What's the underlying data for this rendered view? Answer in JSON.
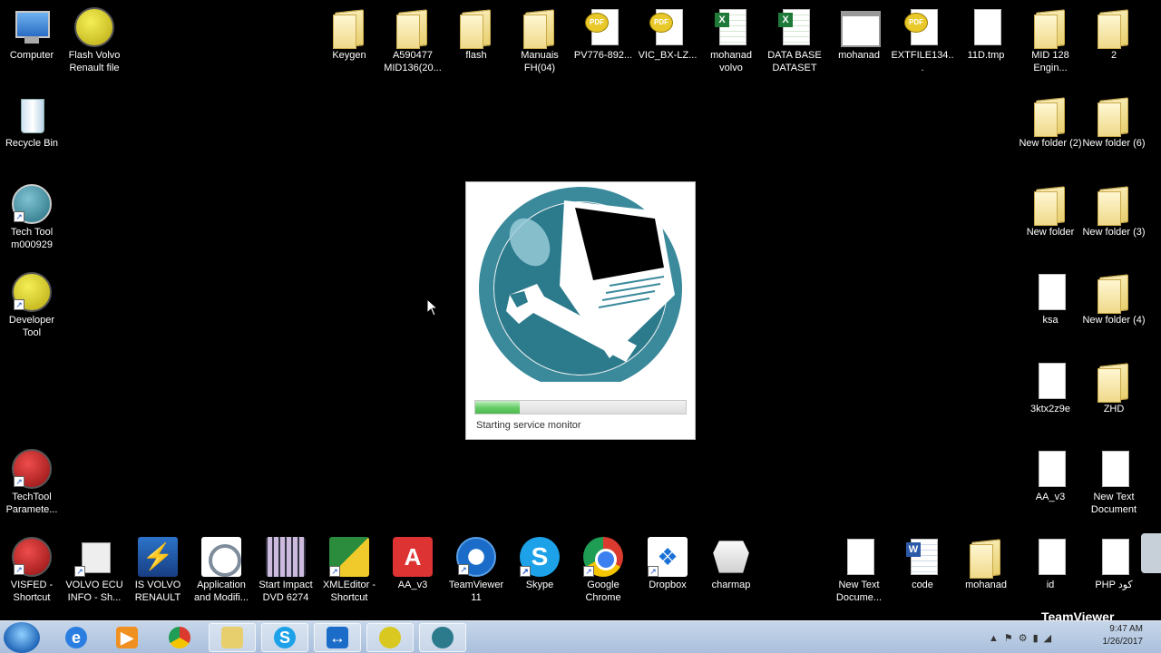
{
  "desktop_left": [
    {
      "label": "Computer",
      "icon": "computer-icon"
    },
    {
      "label": "Flash Volvo Renault file",
      "icon": "flash-volvo-icon"
    },
    {
      "label": "Recycle Bin",
      "icon": "recycle-bin-icon"
    },
    {
      "label": "Tech Tool m000929",
      "icon": "tech-tool-icon"
    },
    {
      "label": "Developer Tool",
      "icon": "developer-tool-icon"
    },
    {
      "label": "TechTool Paramete...",
      "icon": "techtool-parameter-icon"
    }
  ],
  "desktop_top": [
    {
      "label": "Keygen",
      "icon": "folder-icon"
    },
    {
      "label": "A590477 MID136(20...",
      "icon": "folder-icon"
    },
    {
      "label": "flash",
      "icon": "folder-icon"
    },
    {
      "label": "Manuais FH(04)",
      "icon": "folder-icon"
    },
    {
      "label": "PV776-892...",
      "icon": "pdf-icon"
    },
    {
      "label": "VIC_BX-LZ...",
      "icon": "pdf-icon"
    },
    {
      "label": "mohanad volvo",
      "icon": "excel-icon"
    },
    {
      "label": "DATA BASE DATASET",
      "icon": "excel-icon"
    },
    {
      "label": "mohanad",
      "icon": "window-icon"
    },
    {
      "label": "EXTFILE134...",
      "icon": "pdf-icon"
    },
    {
      "label": "11D.tmp",
      "icon": "file-icon"
    },
    {
      "label": "MID 128 Engin...",
      "icon": "folder-icon"
    },
    {
      "label": "2",
      "icon": "folder-icon"
    }
  ],
  "desktop_right": [
    {
      "label": "New folder (2)",
      "icon": "folder-icon"
    },
    {
      "label": "New folder (6)",
      "icon": "folder-icon"
    },
    {
      "label": "New folder",
      "icon": "folder-icon"
    },
    {
      "label": "New folder (3)",
      "icon": "folder-icon"
    },
    {
      "label": "ksa",
      "icon": "file-icon"
    },
    {
      "label": "New folder (4)",
      "icon": "folder-icon"
    },
    {
      "label": "3ktx2z9e",
      "icon": "file-icon"
    },
    {
      "label": "ZHD",
      "icon": "folder-icon"
    },
    {
      "label": "AA_v3",
      "icon": "file-icon"
    },
    {
      "label": "New Text Document",
      "icon": "text-file-icon"
    }
  ],
  "desktop_bottom": [
    {
      "label": "VISFED - Shortcut",
      "icon": "visfed-icon"
    },
    {
      "label": "VOLVO ECU INFO - Sh...",
      "icon": "volvo-ecu-icon"
    },
    {
      "label": "IS VOLVO RENAULT",
      "icon": "lightning-icon"
    },
    {
      "label": "Application and Modifi...",
      "icon": "volvo-logo-icon"
    },
    {
      "label": "Start Impact DVD 6274",
      "icon": "impact-icon"
    },
    {
      "label": "XMLEditor - Shortcut",
      "icon": "xmleditor-icon"
    },
    {
      "label": "AA_v3",
      "icon": "acrobat-icon"
    },
    {
      "label": "TeamViewer 11",
      "icon": "teamviewer-icon"
    },
    {
      "label": "Skype",
      "icon": "skype-icon"
    },
    {
      "label": "Google Chrome",
      "icon": "chrome-icon"
    },
    {
      "label": "Dropbox",
      "icon": "dropbox-icon"
    },
    {
      "label": "charmap",
      "icon": "charmap-icon"
    },
    {
      "label": "New Text Docume...",
      "icon": "text-file-icon"
    },
    {
      "label": "code",
      "icon": "word-icon"
    },
    {
      "label": "mohanad",
      "icon": "folder-icon"
    },
    {
      "label": "id",
      "icon": "file-icon"
    },
    {
      "label": "PHP كود",
      "icon": "file-icon"
    }
  ],
  "splash": {
    "status": "Starting service monitor",
    "progress": 0.21
  },
  "taskbar": {
    "items": [
      "ie-icon",
      "media-player-icon",
      "chrome-icon",
      "explorer-icon",
      "skype-icon",
      "teamviewer-icon",
      "flash-volvo-icon",
      "tech-tool-icon"
    ],
    "clock_time": "9:47 AM",
    "clock_date": "1/26/2017"
  },
  "teamviewer_brand": "TeamViewer"
}
